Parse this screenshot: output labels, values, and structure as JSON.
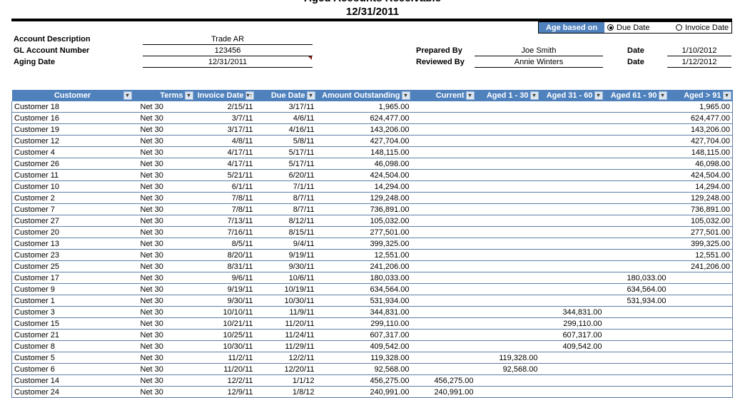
{
  "report": {
    "title": "Aged Accounts Receivable",
    "date": "12/31/2011"
  },
  "age_based_on": {
    "label": "Age based on",
    "options": [
      {
        "label": "Due Date",
        "selected": true
      },
      {
        "label": "Invoice Date",
        "selected": false
      }
    ]
  },
  "info": {
    "account_description_label": "Account Description",
    "account_description": "Trade AR",
    "gl_account_label": "GL Account Number",
    "gl_account": "123456",
    "aging_date_label": "Aging Date",
    "aging_date": "12/31/2011",
    "prepared_by_label": "Prepared By",
    "prepared_by": "Joe Smith",
    "prepared_date_label": "Date",
    "prepared_date": "1/10/2012",
    "reviewed_by_label": "Reviewed By",
    "reviewed_by": "Annie Winters",
    "reviewed_date_label": "Date",
    "reviewed_date": "1/12/2012"
  },
  "table": {
    "columns": [
      {
        "label": "Customer",
        "filter": "dropdown"
      },
      {
        "label": "Terms",
        "filter": "dropdown"
      },
      {
        "label": "Invoice Date",
        "filter": "sorted-ascending"
      },
      {
        "label": "Due Date",
        "filter": "dropdown"
      },
      {
        "label": "Amount Outstanding",
        "filter": "dropdown"
      },
      {
        "label": "Current",
        "filter": "dropdown"
      },
      {
        "label": "Aged 1 - 30",
        "filter": "dropdown"
      },
      {
        "label": "Aged 31 - 60",
        "filter": "dropdown"
      },
      {
        "label": "Aged 61 - 90",
        "filter": "dropdown"
      },
      {
        "label": "Aged > 91",
        "filter": "dropdown"
      }
    ],
    "rows": [
      [
        "Customer 18",
        "Net 30",
        "2/15/11",
        "3/17/11",
        "1,965.00",
        "",
        "",
        "",
        "",
        "1,965.00"
      ],
      [
        "Customer 16",
        "Net 30",
        "3/7/11",
        "4/6/11",
        "624,477.00",
        "",
        "",
        "",
        "",
        "624,477.00"
      ],
      [
        "Customer 19",
        "Net 30",
        "3/17/11",
        "4/16/11",
        "143,206.00",
        "",
        "",
        "",
        "",
        "143,206.00"
      ],
      [
        "Customer 12",
        "Net 30",
        "4/8/11",
        "5/8/11",
        "427,704.00",
        "",
        "",
        "",
        "",
        "427,704.00"
      ],
      [
        "Customer 4",
        "Net 30",
        "4/17/11",
        "5/17/11",
        "148,115.00",
        "",
        "",
        "",
        "",
        "148,115.00"
      ],
      [
        "Customer 26",
        "Net 30",
        "4/17/11",
        "5/17/11",
        "46,098.00",
        "",
        "",
        "",
        "",
        "46,098.00"
      ],
      [
        "Customer 11",
        "Net 30",
        "5/21/11",
        "6/20/11",
        "424,504.00",
        "",
        "",
        "",
        "",
        "424,504.00"
      ],
      [
        "Customer 10",
        "Net 30",
        "6/1/11",
        "7/1/11",
        "14,294.00",
        "",
        "",
        "",
        "",
        "14,294.00"
      ],
      [
        "Customer 2",
        "Net 30",
        "7/8/11",
        "8/7/11",
        "129,248.00",
        "",
        "",
        "",
        "",
        "129,248.00"
      ],
      [
        "Customer 7",
        "Net 30",
        "7/8/11",
        "8/7/11",
        "736,891.00",
        "",
        "",
        "",
        "",
        "736,891.00"
      ],
      [
        "Customer 27",
        "Net 30",
        "7/13/11",
        "8/12/11",
        "105,032.00",
        "",
        "",
        "",
        "",
        "105,032.00"
      ],
      [
        "Customer 20",
        "Net 30",
        "7/16/11",
        "8/15/11",
        "277,501.00",
        "",
        "",
        "",
        "",
        "277,501.00"
      ],
      [
        "Customer 13",
        "Net 30",
        "8/5/11",
        "9/4/11",
        "399,325.00",
        "",
        "",
        "",
        "",
        "399,325.00"
      ],
      [
        "Customer 23",
        "Net 30",
        "8/20/11",
        "9/19/11",
        "12,551.00",
        "",
        "",
        "",
        "",
        "12,551.00"
      ],
      [
        "Customer 25",
        "Net 30",
        "8/31/11",
        "9/30/11",
        "241,206.00",
        "",
        "",
        "",
        "",
        "241,206.00"
      ],
      [
        "Customer 17",
        "Net 30",
        "9/6/11",
        "10/6/11",
        "180,033.00",
        "",
        "",
        "",
        "180,033.00",
        ""
      ],
      [
        "Customer 9",
        "Net 30",
        "9/19/11",
        "10/19/11",
        "634,564.00",
        "",
        "",
        "",
        "634,564.00",
        ""
      ],
      [
        "Customer 1",
        "Net 30",
        "9/30/11",
        "10/30/11",
        "531,934.00",
        "",
        "",
        "",
        "531,934.00",
        ""
      ],
      [
        "Customer 3",
        "Net 30",
        "10/10/11",
        "11/9/11",
        "344,831.00",
        "",
        "",
        "344,831.00",
        "",
        ""
      ],
      [
        "Customer 15",
        "Net 30",
        "10/21/11",
        "11/20/11",
        "299,110.00",
        "",
        "",
        "299,110.00",
        "",
        ""
      ],
      [
        "Customer 21",
        "Net 30",
        "10/25/11",
        "11/24/11",
        "607,317.00",
        "",
        "",
        "607,317.00",
        "",
        ""
      ],
      [
        "Customer 8",
        "Net 30",
        "10/30/11",
        "11/29/11",
        "409,542.00",
        "",
        "",
        "409,542.00",
        "",
        ""
      ],
      [
        "Customer 5",
        "Net 30",
        "11/2/11",
        "12/2/11",
        "119,328.00",
        "",
        "119,328.00",
        "",
        "",
        ""
      ],
      [
        "Customer 6",
        "Net 30",
        "11/20/11",
        "12/20/11",
        "92,568.00",
        "",
        "92,568.00",
        "",
        "",
        ""
      ],
      [
        "Customer 14",
        "Net 30",
        "12/2/11",
        "1/1/12",
        "456,275.00",
        "456,275.00",
        "",
        "",
        "",
        ""
      ],
      [
        "Customer 24",
        "Net 30",
        "12/9/11",
        "1/8/12",
        "240,991.00",
        "240,991.00",
        "",
        "",
        "",
        ""
      ]
    ]
  }
}
